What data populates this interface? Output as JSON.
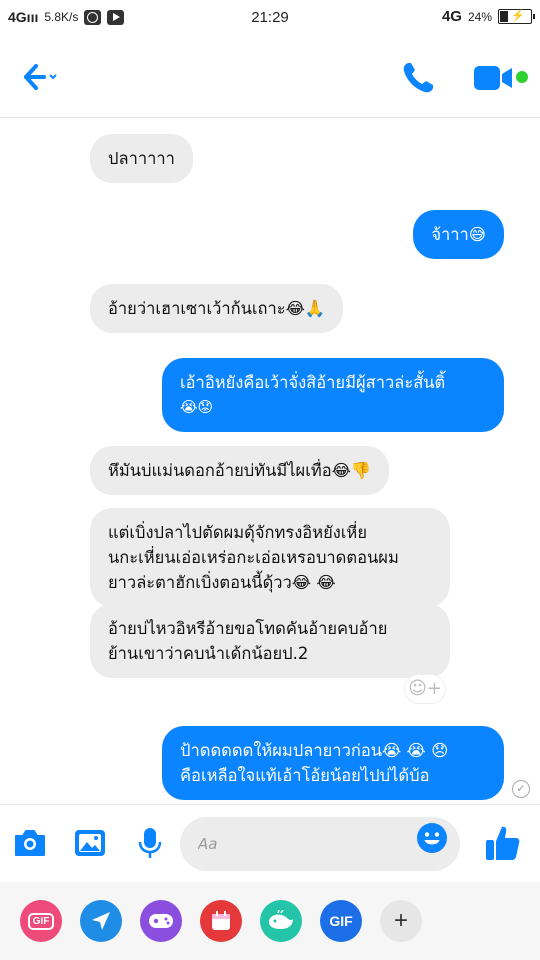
{
  "status_bar": {
    "network": "4Gııı",
    "speed": "5.8K/s",
    "time": "21:29",
    "network_right": "4G",
    "battery": "24%"
  },
  "header": {
    "contact_name": "",
    "icons": [
      "back-arrow-icon",
      "phone-icon",
      "video-camera-icon"
    ],
    "accent_color": "#0a84ff",
    "online_color": "#2ed12e"
  },
  "messages": [
    {
      "dir": "in",
      "text": "ปลาาาาา"
    },
    {
      "dir": "out",
      "text": "จ้าาา😅"
    },
    {
      "dir": "in",
      "text": "อ้ายว่าเฮาเซาเว้าก้นเถาะ😂🙏"
    },
    {
      "dir": "out",
      "line1": "เอ้าอิหยังคือเว้าจั่งสิอ้ายมีผู้สาวล่ะสั้นติ้",
      "line2": "😭😟"
    },
    {
      "dir": "in",
      "text": "หึมันบ่แม่นดอกอ้ายบ่ทันมีไผเทื่อ😂👎"
    },
    {
      "dir": "in",
      "line1": "แต่เบิ่งปลาไปตัดผมดุ้จักทรงอิหยังเหี่ย",
      "line2": "นกะเหี่ยนเอ่อเหร่อกะเอ่อเหรอบาดตอนผม",
      "line3": "ยาวล่ะตาฮักเบิ่งตอนนี้ดุ้วว😂 😂"
    },
    {
      "dir": "in",
      "line1": "อ้ายบ่ไหวอิหรีอ้ายขอโทดคันอ้ายคบอ้าย",
      "line2": "ย้านเขาว่าคบนำเด้กน้อยป.2"
    },
    {
      "dir": "out",
      "line1": "ป้าดดดดดให้ผมปลายาวก่อน😭 😭 😞",
      "line2": "คือเหลือใจแท้เอ้าโอ้ยน้อยไปบ่ได้บ้อ"
    }
  ],
  "composer": {
    "placeholder": "Aa",
    "icons": [
      "camera-icon",
      "gallery-icon",
      "microphone-icon",
      "emoji-icon",
      "like-thumb-icon"
    ]
  },
  "tray": [
    {
      "name": "gif-sticker",
      "label": "GIF",
      "color": "#ee4a7a"
    },
    {
      "name": "location",
      "label": "",
      "color": "#1f8ce6"
    },
    {
      "name": "games",
      "label": "",
      "color": "#8b4fe0"
    },
    {
      "name": "calendar",
      "label": "",
      "color": "#e5383b"
    },
    {
      "name": "whale-sticker",
      "label": "",
      "color": "#23c4a8"
    },
    {
      "name": "gif-search",
      "label": "GIF",
      "color": "#1d6fe8"
    },
    {
      "name": "more",
      "label": "+",
      "color": "#e6e6e6"
    }
  ]
}
